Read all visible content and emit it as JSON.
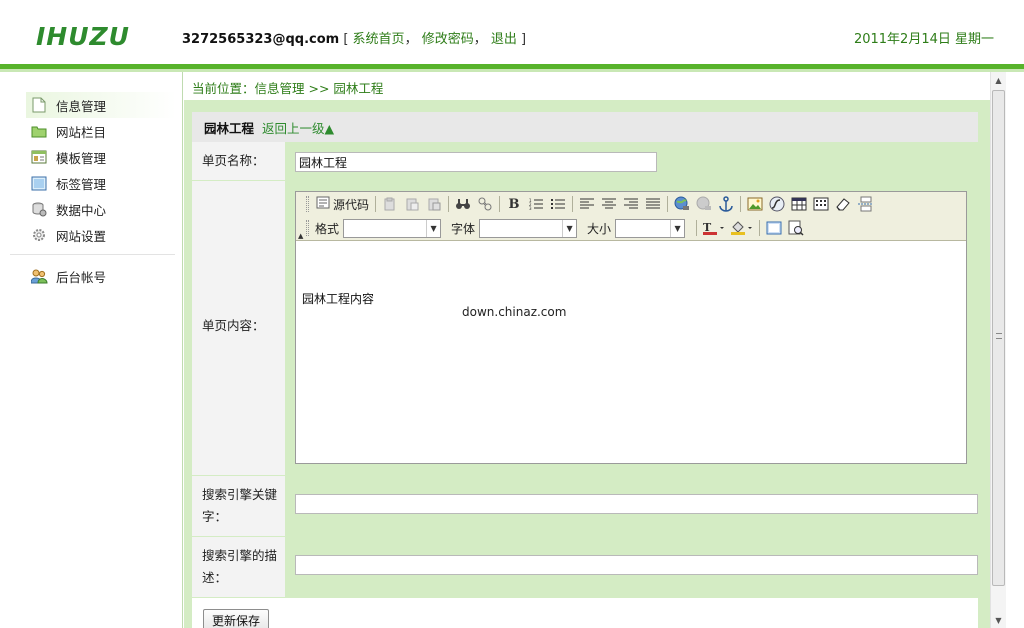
{
  "header": {
    "logo": "IHUZU",
    "email": "3272565323@qq.com",
    "bracket_open": "[",
    "bracket_close": "]",
    "links": [
      "系统首页",
      "修改密码",
      "退出"
    ],
    "date": "2011年2月14日 星期一"
  },
  "sidebar": {
    "items": [
      {
        "label": "信息管理",
        "icon": "document-icon",
        "active": true
      },
      {
        "label": "网站栏目",
        "icon": "folder-icon"
      },
      {
        "label": "模板管理",
        "icon": "template-icon"
      },
      {
        "label": "标签管理",
        "icon": "tag-icon"
      },
      {
        "label": "数据中心",
        "icon": "database-icon"
      },
      {
        "label": "网站设置",
        "icon": "gear-icon"
      }
    ],
    "account": {
      "label": "后台帐号",
      "icon": "users-icon"
    }
  },
  "main": {
    "breadcrumb": "当前位置：信息管理 >> 园林工程",
    "title": "园林工程",
    "back_link": "返回上一级▲",
    "form": {
      "name_label": "单页名称：",
      "name_value": "园林工程",
      "content_label": "单页内容：",
      "content_value": "园林工程内容",
      "keywords_label": "搜索引擎关键字：",
      "keywords_value": "",
      "description_label": "搜索引擎的描述：",
      "description_value": "",
      "submit_label": "更新保存"
    },
    "editor": {
      "source_label": "源代码",
      "format_label": "格式",
      "font_label": "字体",
      "size_label": "大小"
    },
    "watermark": "down.chinaz.com"
  }
}
